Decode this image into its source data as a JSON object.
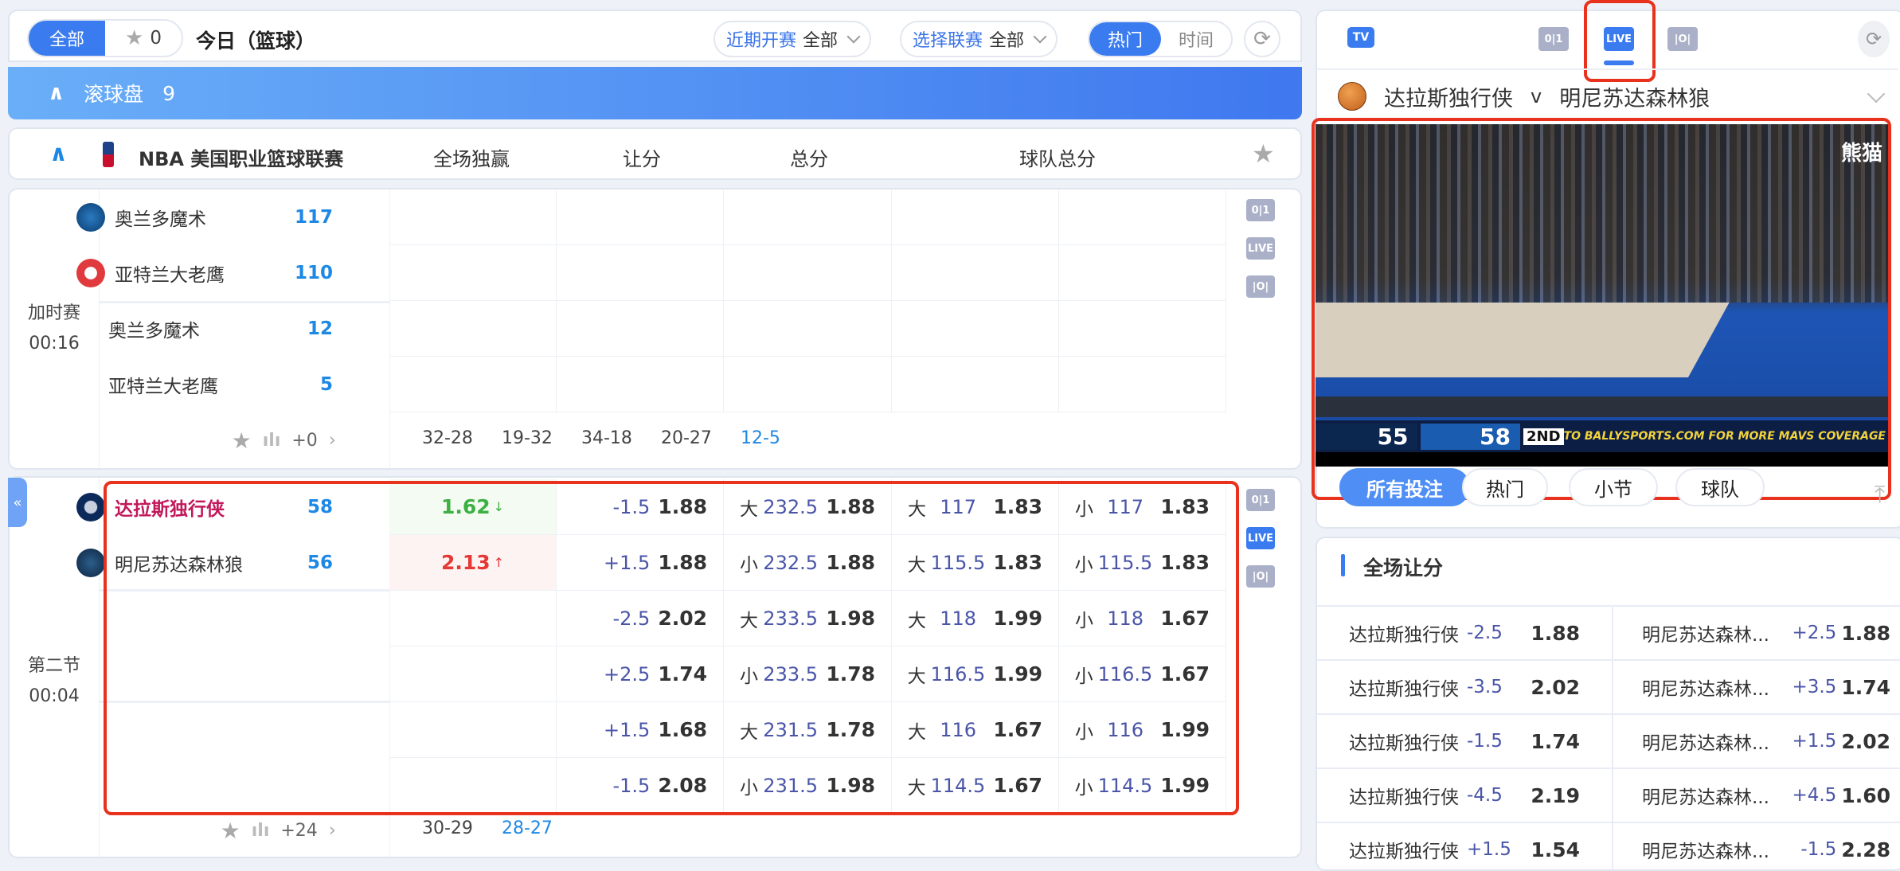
{
  "toolbar": {
    "all_label": "全部",
    "fav_count": "0",
    "title": "今日（篮球）",
    "recent_label": "近期开赛",
    "recent_value": "全部",
    "league_label": "选择联赛",
    "league_value": "全部",
    "hot_label": "热门",
    "time_label": "时间"
  },
  "banner": {
    "label": "滚球盘",
    "count": "9"
  },
  "league": {
    "name": "NBA 美国职业篮球联赛",
    "columns": [
      "全场独赢",
      "让分",
      "总分",
      "球队总分"
    ]
  },
  "game1": {
    "period": "加时赛",
    "clock": "00:16",
    "home": "奥兰多魔术",
    "home_score": "117",
    "away": "亚特兰大老鹰",
    "away_score": "110",
    "sub_home": "奥兰多魔术",
    "sub_home_score": "12",
    "sub_away": "亚特兰大老鹰",
    "sub_away_score": "5",
    "more": "+0",
    "quarters": [
      "32-28",
      "19-32",
      "34-18",
      "20-27",
      "12-5"
    ]
  },
  "game2": {
    "period": "第二节",
    "clock": "00:04",
    "home": "达拉斯独行侠",
    "home_score": "58",
    "away": "明尼苏达森林狼",
    "away_score": "56",
    "more": "+24",
    "quarters": [
      "30-29",
      "28-27"
    ],
    "moneyline": [
      {
        "value": "1.62",
        "dir": "down",
        "color": "#3cb043"
      },
      {
        "value": "2.13",
        "dir": "up",
        "color": "#e53935"
      }
    ],
    "rows": [
      {
        "h": [
          "-1.5",
          "1.88"
        ],
        "t": [
          "大",
          "232.5",
          "1.88"
        ],
        "a": [
          "大",
          "117",
          "1.83"
        ],
        "b": [
          "小",
          "117",
          "1.83"
        ]
      },
      {
        "h": [
          "+1.5",
          "1.88"
        ],
        "t": [
          "小",
          "232.5",
          "1.88"
        ],
        "a": [
          "大",
          "115.5",
          "1.83"
        ],
        "b": [
          "小",
          "115.5",
          "1.83"
        ]
      },
      {
        "h": [
          "-2.5",
          "2.02"
        ],
        "t": [
          "大",
          "233.5",
          "1.98"
        ],
        "a": [
          "大",
          "118",
          "1.99"
        ],
        "b": [
          "小",
          "118",
          "1.67"
        ]
      },
      {
        "h": [
          "+2.5",
          "1.74"
        ],
        "t": [
          "小",
          "233.5",
          "1.78"
        ],
        "a": [
          "大",
          "116.5",
          "1.99"
        ],
        "b": [
          "小",
          "116.5",
          "1.67"
        ]
      },
      {
        "h": [
          "+1.5",
          "1.68"
        ],
        "t": [
          "大",
          "231.5",
          "1.78"
        ],
        "a": [
          "大",
          "116",
          "1.67"
        ],
        "b": [
          "小",
          "116",
          "1.99"
        ]
      },
      {
        "h": [
          "-1.5",
          "2.08"
        ],
        "t": [
          "小",
          "231.5",
          "1.98"
        ],
        "a": [
          "大",
          "114.5",
          "1.67"
        ],
        "b": [
          "小",
          "114.5",
          "1.99"
        ]
      }
    ]
  },
  "icons": {
    "score": "0|1",
    "live": "LIVE",
    "field": "|O|",
    "tv": "TV"
  },
  "right": {
    "match_home": "达拉斯独行侠",
    "vs": "v",
    "match_away": "明尼苏达森林狼",
    "video": {
      "score_away": "55",
      "score_home": "58",
      "period": "2ND",
      "banner": "TO BALLYSPORTS.COM FOR MORE MAVS COVERAGE",
      "watermark": "熊猫"
    },
    "bet_tabs": [
      "所有投注",
      "热门",
      "小节",
      "球队"
    ],
    "section_title": "全场让分",
    "spreads": [
      {
        "home": "达拉斯独行侠",
        "hl": "-2.5",
        "ho": "1.88",
        "away": "明尼苏达森林...",
        "al": "+2.5",
        "ao": "1.88"
      },
      {
        "home": "达拉斯独行侠",
        "hl": "-3.5",
        "ho": "2.02",
        "away": "明尼苏达森林...",
        "al": "+3.5",
        "ao": "1.74"
      },
      {
        "home": "达拉斯独行侠",
        "hl": "-1.5",
        "ho": "1.74",
        "away": "明尼苏达森林...",
        "al": "+1.5",
        "ao": "2.02"
      },
      {
        "home": "达拉斯独行侠",
        "hl": "-4.5",
        "ho": "2.19",
        "away": "明尼苏达森林...",
        "al": "+4.5",
        "ao": "1.60"
      },
      {
        "home": "达拉斯独行侠",
        "hl": "+1.5",
        "ho": "1.54",
        "away": "明尼苏达森林...",
        "al": "-1.5",
        "ao": "2.28"
      }
    ]
  },
  "colors": {
    "accent": "#3a7bf0",
    "highlight": "#e8321e",
    "score": "#1e88e5"
  }
}
